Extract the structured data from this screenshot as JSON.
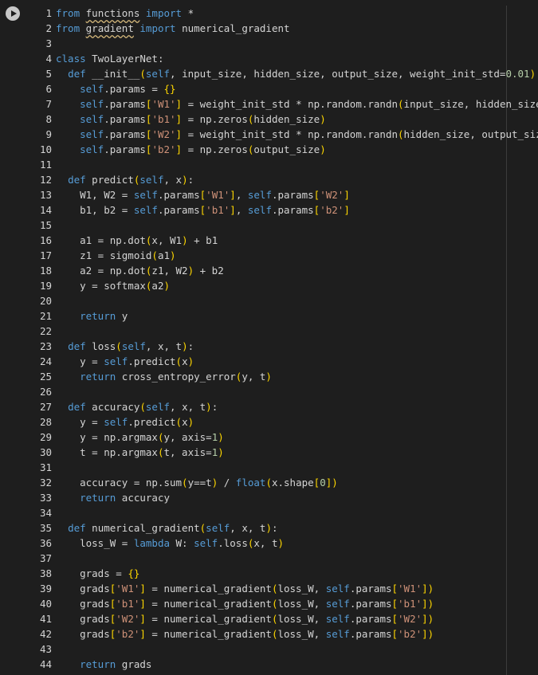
{
  "toolbar": {
    "run_icon": "play-icon"
  },
  "colors": {
    "background": "#1e1e1e",
    "text": "#d4d4d4",
    "keyword": "#569cd6",
    "string": "#ce9178",
    "number": "#b5cea8",
    "bracket": "#ffd700"
  },
  "lines": [
    {
      "n": "1",
      "tokens": [
        [
          "k",
          "from"
        ],
        [
          "p",
          " "
        ],
        [
          "u",
          "functions"
        ],
        [
          "p",
          " "
        ],
        [
          "k",
          "import"
        ],
        [
          "p",
          " *"
        ]
      ]
    },
    {
      "n": "2",
      "tokens": [
        [
          "k",
          "from"
        ],
        [
          "p",
          " "
        ],
        [
          "u",
          "gradient"
        ],
        [
          "p",
          " "
        ],
        [
          "k",
          "import"
        ],
        [
          "p",
          " numerical_gradient"
        ]
      ]
    },
    {
      "n": "3",
      "tokens": []
    },
    {
      "n": "4",
      "tokens": [
        [
          "k",
          "class"
        ],
        [
          "p",
          " TwoLayerNet:"
        ]
      ]
    },
    {
      "n": "5",
      "tokens": [
        [
          "p",
          "  "
        ],
        [
          "k",
          "def"
        ],
        [
          "p",
          " __init__"
        ],
        [
          "b",
          "("
        ],
        [
          "k",
          "self"
        ],
        [
          "p",
          ", input_size, hidden_size, output_size, weight_init_std="
        ],
        [
          "n",
          "0.01"
        ],
        [
          "b",
          ")"
        ],
        [
          "p",
          ":"
        ]
      ]
    },
    {
      "n": "6",
      "tokens": [
        [
          "p",
          "    "
        ],
        [
          "k",
          "self"
        ],
        [
          "p",
          ".params = "
        ],
        [
          "b",
          "{}"
        ]
      ]
    },
    {
      "n": "7",
      "tokens": [
        [
          "p",
          "    "
        ],
        [
          "k",
          "self"
        ],
        [
          "p",
          ".params"
        ],
        [
          "b",
          "["
        ],
        [
          "s",
          "'W1'"
        ],
        [
          "b",
          "]"
        ],
        [
          "p",
          " = weight_init_std * np.random.randn"
        ],
        [
          "b",
          "("
        ],
        [
          "p",
          "input_size, hidden_size"
        ],
        [
          "b",
          ")"
        ]
      ]
    },
    {
      "n": "8",
      "tokens": [
        [
          "p",
          "    "
        ],
        [
          "k",
          "self"
        ],
        [
          "p",
          ".params"
        ],
        [
          "b",
          "["
        ],
        [
          "s",
          "'b1'"
        ],
        [
          "b",
          "]"
        ],
        [
          "p",
          " = np.zeros"
        ],
        [
          "b",
          "("
        ],
        [
          "p",
          "hidden_size"
        ],
        [
          "b",
          ")"
        ]
      ]
    },
    {
      "n": "9",
      "tokens": [
        [
          "p",
          "    "
        ],
        [
          "k",
          "self"
        ],
        [
          "p",
          ".params"
        ],
        [
          "b",
          "["
        ],
        [
          "s",
          "'W2'"
        ],
        [
          "b",
          "]"
        ],
        [
          "p",
          " = weight_init_std * np.random.randn"
        ],
        [
          "b",
          "("
        ],
        [
          "p",
          "hidden_size, output_size"
        ],
        [
          "b",
          ")"
        ]
      ]
    },
    {
      "n": "10",
      "tokens": [
        [
          "p",
          "    "
        ],
        [
          "k",
          "self"
        ],
        [
          "p",
          ".params"
        ],
        [
          "b",
          "["
        ],
        [
          "s",
          "'b2'"
        ],
        [
          "b",
          "]"
        ],
        [
          "p",
          " = np.zeros"
        ],
        [
          "b",
          "("
        ],
        [
          "p",
          "output_size"
        ],
        [
          "b",
          ")"
        ]
      ]
    },
    {
      "n": "11",
      "tokens": []
    },
    {
      "n": "12",
      "tokens": [
        [
          "p",
          "  "
        ],
        [
          "k",
          "def"
        ],
        [
          "p",
          " predict"
        ],
        [
          "b",
          "("
        ],
        [
          "k",
          "self"
        ],
        [
          "p",
          ", x"
        ],
        [
          "b",
          ")"
        ],
        [
          "p",
          ":"
        ]
      ]
    },
    {
      "n": "13",
      "tokens": [
        [
          "p",
          "    W1, W2 = "
        ],
        [
          "k",
          "self"
        ],
        [
          "p",
          ".params"
        ],
        [
          "b",
          "["
        ],
        [
          "s",
          "'W1'"
        ],
        [
          "b",
          "]"
        ],
        [
          "p",
          ", "
        ],
        [
          "k",
          "self"
        ],
        [
          "p",
          ".params"
        ],
        [
          "b",
          "["
        ],
        [
          "s",
          "'W2'"
        ],
        [
          "b",
          "]"
        ]
      ]
    },
    {
      "n": "14",
      "tokens": [
        [
          "p",
          "    b1, b2 = "
        ],
        [
          "k",
          "self"
        ],
        [
          "p",
          ".params"
        ],
        [
          "b",
          "["
        ],
        [
          "s",
          "'b1'"
        ],
        [
          "b",
          "]"
        ],
        [
          "p",
          ", "
        ],
        [
          "k",
          "self"
        ],
        [
          "p",
          ".params"
        ],
        [
          "b",
          "["
        ],
        [
          "s",
          "'b2'"
        ],
        [
          "b",
          "]"
        ]
      ]
    },
    {
      "n": "15",
      "tokens": []
    },
    {
      "n": "16",
      "tokens": [
        [
          "p",
          "    a1 = np.dot"
        ],
        [
          "b",
          "("
        ],
        [
          "p",
          "x, W1"
        ],
        [
          "b",
          ")"
        ],
        [
          "p",
          " + b1"
        ]
      ]
    },
    {
      "n": "17",
      "tokens": [
        [
          "p",
          "    z1 = sigmoid"
        ],
        [
          "b",
          "("
        ],
        [
          "p",
          "a1"
        ],
        [
          "b",
          ")"
        ]
      ]
    },
    {
      "n": "18",
      "tokens": [
        [
          "p",
          "    a2 = np.dot"
        ],
        [
          "b",
          "("
        ],
        [
          "p",
          "z1, W2"
        ],
        [
          "b",
          ")"
        ],
        [
          "p",
          " + b2"
        ]
      ]
    },
    {
      "n": "19",
      "tokens": [
        [
          "p",
          "    y = softmax"
        ],
        [
          "b",
          "("
        ],
        [
          "p",
          "a2"
        ],
        [
          "b",
          ")"
        ]
      ]
    },
    {
      "n": "20",
      "tokens": []
    },
    {
      "n": "21",
      "tokens": [
        [
          "p",
          "    "
        ],
        [
          "k",
          "return"
        ],
        [
          "p",
          " y"
        ]
      ]
    },
    {
      "n": "22",
      "tokens": []
    },
    {
      "n": "23",
      "tokens": [
        [
          "p",
          "  "
        ],
        [
          "k",
          "def"
        ],
        [
          "p",
          " loss"
        ],
        [
          "b",
          "("
        ],
        [
          "k",
          "self"
        ],
        [
          "p",
          ", x, t"
        ],
        [
          "b",
          ")"
        ],
        [
          "p",
          ":"
        ]
      ]
    },
    {
      "n": "24",
      "tokens": [
        [
          "p",
          "    y = "
        ],
        [
          "k",
          "self"
        ],
        [
          "p",
          ".predict"
        ],
        [
          "b",
          "("
        ],
        [
          "p",
          "x"
        ],
        [
          "b",
          ")"
        ]
      ]
    },
    {
      "n": "25",
      "tokens": [
        [
          "p",
          "    "
        ],
        [
          "k",
          "return"
        ],
        [
          "p",
          " cross_entropy_error"
        ],
        [
          "b",
          "("
        ],
        [
          "p",
          "y, t"
        ],
        [
          "b",
          ")"
        ]
      ]
    },
    {
      "n": "26",
      "tokens": []
    },
    {
      "n": "27",
      "tokens": [
        [
          "p",
          "  "
        ],
        [
          "k",
          "def"
        ],
        [
          "p",
          " accuracy"
        ],
        [
          "b",
          "("
        ],
        [
          "k",
          "self"
        ],
        [
          "p",
          ", x, t"
        ],
        [
          "b",
          ")"
        ],
        [
          "p",
          ":"
        ]
      ]
    },
    {
      "n": "28",
      "tokens": [
        [
          "p",
          "    y = "
        ],
        [
          "k",
          "self"
        ],
        [
          "p",
          ".predict"
        ],
        [
          "b",
          "("
        ],
        [
          "p",
          "x"
        ],
        [
          "b",
          ")"
        ]
      ]
    },
    {
      "n": "29",
      "tokens": [
        [
          "p",
          "    y = np.argmax"
        ],
        [
          "b",
          "("
        ],
        [
          "p",
          "y, axis="
        ],
        [
          "n",
          "1"
        ],
        [
          "b",
          ")"
        ]
      ]
    },
    {
      "n": "30",
      "tokens": [
        [
          "p",
          "    t = np.argmax"
        ],
        [
          "b",
          "("
        ],
        [
          "p",
          "t, axis="
        ],
        [
          "n",
          "1"
        ],
        [
          "b",
          ")"
        ]
      ]
    },
    {
      "n": "31",
      "tokens": []
    },
    {
      "n": "32",
      "tokens": [
        [
          "p",
          "    accuracy = np.sum"
        ],
        [
          "b",
          "("
        ],
        [
          "p",
          "y==t"
        ],
        [
          "b",
          ")"
        ],
        [
          "p",
          " / "
        ],
        [
          "k",
          "float"
        ],
        [
          "b",
          "("
        ],
        [
          "p",
          "x.shape"
        ],
        [
          "b",
          "["
        ],
        [
          "n",
          "0"
        ],
        [
          "b",
          "]"
        ],
        [
          "b",
          ")"
        ]
      ]
    },
    {
      "n": "33",
      "tokens": [
        [
          "p",
          "    "
        ],
        [
          "k",
          "return"
        ],
        [
          "p",
          " accuracy"
        ]
      ]
    },
    {
      "n": "34",
      "tokens": []
    },
    {
      "n": "35",
      "tokens": [
        [
          "p",
          "  "
        ],
        [
          "k",
          "def"
        ],
        [
          "p",
          " numerical_gradient"
        ],
        [
          "b",
          "("
        ],
        [
          "k",
          "self"
        ],
        [
          "p",
          ", x, t"
        ],
        [
          "b",
          ")"
        ],
        [
          "p",
          ":"
        ]
      ]
    },
    {
      "n": "36",
      "tokens": [
        [
          "p",
          "    loss_W = "
        ],
        [
          "k",
          "lambda"
        ],
        [
          "p",
          " W: "
        ],
        [
          "k",
          "self"
        ],
        [
          "p",
          ".loss"
        ],
        [
          "b",
          "("
        ],
        [
          "p",
          "x, t"
        ],
        [
          "b",
          ")"
        ]
      ]
    },
    {
      "n": "37",
      "tokens": []
    },
    {
      "n": "38",
      "tokens": [
        [
          "p",
          "    grads = "
        ],
        [
          "b",
          "{}"
        ]
      ]
    },
    {
      "n": "39",
      "tokens": [
        [
          "p",
          "    grads"
        ],
        [
          "b",
          "["
        ],
        [
          "s",
          "'W1'"
        ],
        [
          "b",
          "]"
        ],
        [
          "p",
          " = numerical_gradient"
        ],
        [
          "b",
          "("
        ],
        [
          "p",
          "loss_W, "
        ],
        [
          "k",
          "self"
        ],
        [
          "p",
          ".params"
        ],
        [
          "b",
          "["
        ],
        [
          "s",
          "'W1'"
        ],
        [
          "b",
          "]"
        ],
        [
          "b",
          ")"
        ]
      ]
    },
    {
      "n": "40",
      "tokens": [
        [
          "p",
          "    grads"
        ],
        [
          "b",
          "["
        ],
        [
          "s",
          "'b1'"
        ],
        [
          "b",
          "]"
        ],
        [
          "p",
          " = numerical_gradient"
        ],
        [
          "b",
          "("
        ],
        [
          "p",
          "loss_W, "
        ],
        [
          "k",
          "self"
        ],
        [
          "p",
          ".params"
        ],
        [
          "b",
          "["
        ],
        [
          "s",
          "'b1'"
        ],
        [
          "b",
          "]"
        ],
        [
          "b",
          ")"
        ]
      ]
    },
    {
      "n": "41",
      "tokens": [
        [
          "p",
          "    grads"
        ],
        [
          "b",
          "["
        ],
        [
          "s",
          "'W2'"
        ],
        [
          "b",
          "]"
        ],
        [
          "p",
          " = numerical_gradient"
        ],
        [
          "b",
          "("
        ],
        [
          "p",
          "loss_W, "
        ],
        [
          "k",
          "self"
        ],
        [
          "p",
          ".params"
        ],
        [
          "b",
          "["
        ],
        [
          "s",
          "'W2'"
        ],
        [
          "b",
          "]"
        ],
        [
          "b",
          ")"
        ]
      ]
    },
    {
      "n": "42",
      "tokens": [
        [
          "p",
          "    grads"
        ],
        [
          "b",
          "["
        ],
        [
          "s",
          "'b2'"
        ],
        [
          "b",
          "]"
        ],
        [
          "p",
          " = numerical_gradient"
        ],
        [
          "b",
          "("
        ],
        [
          "p",
          "loss_W, "
        ],
        [
          "k",
          "self"
        ],
        [
          "p",
          ".params"
        ],
        [
          "b",
          "["
        ],
        [
          "s",
          "'b2'"
        ],
        [
          "b",
          "]"
        ],
        [
          "b",
          ")"
        ]
      ]
    },
    {
      "n": "43",
      "tokens": []
    },
    {
      "n": "44",
      "tokens": [
        [
          "p",
          "    "
        ],
        [
          "k",
          "return"
        ],
        [
          "p",
          " grads"
        ]
      ]
    }
  ]
}
